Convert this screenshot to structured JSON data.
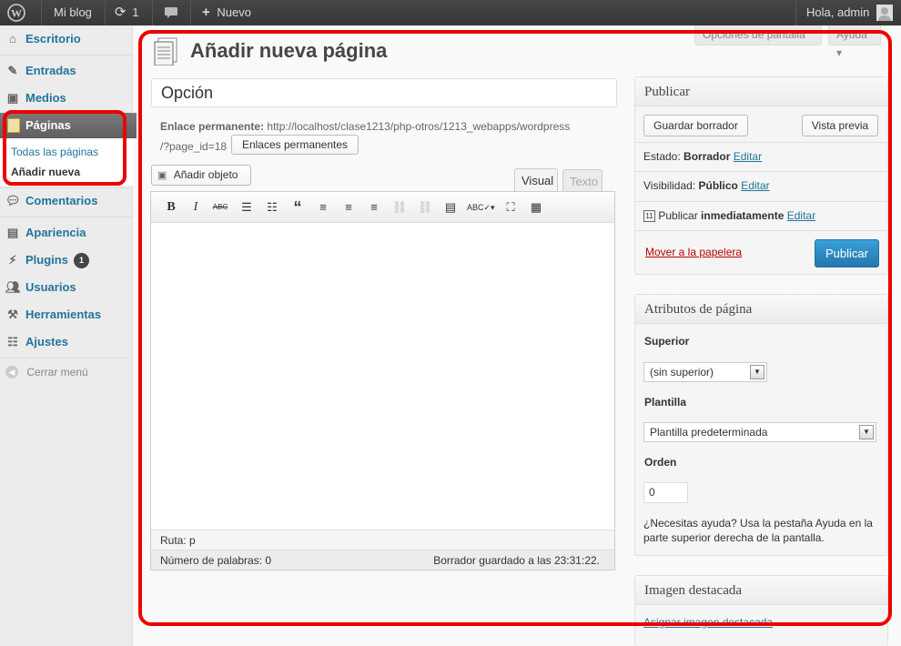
{
  "adminbar": {
    "site_name": "Mi blog",
    "updates_count": "1",
    "new_label": "Nuevo",
    "greeting": "Hola, admin"
  },
  "sidebar": {
    "items": [
      {
        "label": "Escritorio",
        "icon": "dashboard-icon"
      },
      {
        "label": "Entradas",
        "icon": "pushpin-icon"
      },
      {
        "label": "Medios",
        "icon": "media-icon"
      },
      {
        "label": "Páginas",
        "icon": "pages-icon"
      },
      {
        "label": "Comentarios",
        "icon": "comment-icon"
      },
      {
        "label": "Apariencia",
        "icon": "appearance-icon"
      },
      {
        "label": "Plugins",
        "icon": "plugin-icon",
        "badge": "1"
      },
      {
        "label": "Usuarios",
        "icon": "users-icon"
      },
      {
        "label": "Herramientas",
        "icon": "tools-icon"
      },
      {
        "label": "Ajustes",
        "icon": "settings-icon"
      }
    ],
    "submenu": [
      "Todas las páginas",
      "Añadir nueva"
    ],
    "collapse_label": "Cerrar menú"
  },
  "screen_options": {
    "options_label": "Opciones de pantalla",
    "help_label": "Ayuda"
  },
  "page": {
    "title": "Añadir nueva página",
    "post_title": "Opción",
    "permalink_label": "Enlace permanente:",
    "permalink_url_1": "http://localhost/clase1213/php-otros/1213_webapps/wordpress",
    "permalink_url_2": "/?page_id=18",
    "permalink_button": "Enlaces permanentes"
  },
  "editor": {
    "add_media": "Añadir objeto",
    "tab_visual": "Visual",
    "tab_text": "Texto",
    "path": "Ruta: p",
    "word_count": "Número de palabras: 0",
    "draft_saved": "Borrador guardado a las 23:31:22."
  },
  "publish": {
    "title": "Publicar",
    "save_draft": "Guardar borrador",
    "preview": "Vista previa",
    "status_label": "Estado:",
    "status_value": "Borrador",
    "visibility_label": "Visibilidad:",
    "visibility_value": "Público",
    "publish_label": "Publicar",
    "publish_value": "inmediatamente",
    "edit": "Editar",
    "trash": "Mover a la papelera",
    "publish_button": "Publicar"
  },
  "attributes": {
    "title": "Atributos de página",
    "parent_label": "Superior",
    "parent_value": "(sin superior)",
    "template_label": "Plantilla",
    "template_value": "Plantilla predeterminada",
    "order_label": "Orden",
    "order_value": "0",
    "help_text": "¿Necesitas ayuda? Usa la pestaña Ayuda en la parte superior derecha de la pantalla."
  },
  "featured": {
    "title": "Imagen destacada",
    "link": "Asignar imagen destacada"
  },
  "colors": {
    "link": "#21759b",
    "publish_button": "#2e8fcb",
    "highlight": "#e00000",
    "admin_bar": "#464646"
  }
}
